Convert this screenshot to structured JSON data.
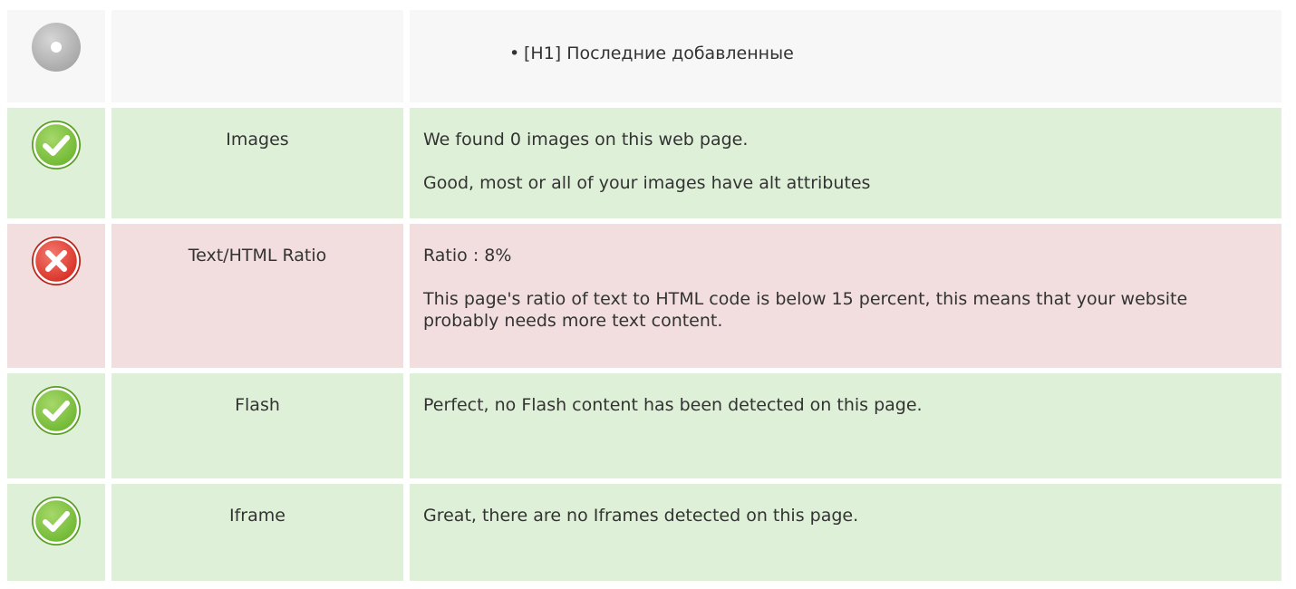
{
  "colors": {
    "neutral_bg": "#f7f7f7",
    "good_bg": "#dff0d8",
    "bad_bg": "#f2dede",
    "good_icon": "#7dc242",
    "bad_icon": "#e53935",
    "neutral_icon": "#bdbdbd"
  },
  "rows": [
    {
      "status": "neutral",
      "icon": "neutral-circle-icon",
      "label": "",
      "list_items": [
        "[H1] Последние добавленные"
      ]
    },
    {
      "status": "good",
      "icon": "checkmark-icon",
      "label": "Images",
      "paragraphs": [
        "We found 0 images on this web page.",
        "Good, most or all of your images have alt attributes"
      ]
    },
    {
      "status": "bad",
      "icon": "cross-icon",
      "label": "Text/HTML Ratio",
      "paragraphs": [
        "Ratio : 8%",
        "This page's ratio of text to HTML code is below 15 percent, this means that your website probably needs more text content."
      ]
    },
    {
      "status": "good",
      "icon": "checkmark-icon",
      "label": "Flash",
      "paragraphs": [
        "Perfect, no Flash content has been detected on this page."
      ]
    },
    {
      "status": "good",
      "icon": "checkmark-icon",
      "label": "Iframe",
      "paragraphs": [
        "Great, there are no Iframes detected on this page."
      ]
    }
  ]
}
